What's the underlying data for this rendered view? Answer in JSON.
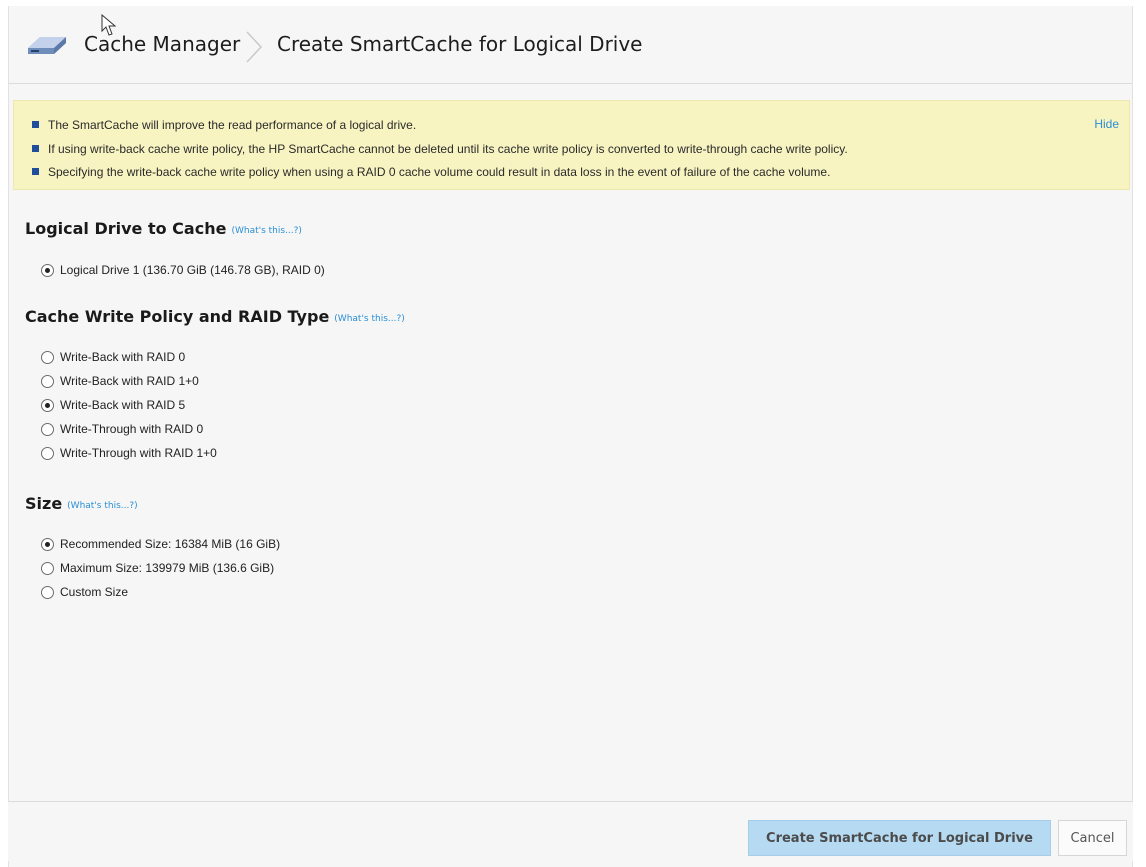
{
  "breadcrumb": {
    "parent": "Cache Manager",
    "current": "Create SmartCache for Logical Drive"
  },
  "notice": {
    "hide_label": "Hide",
    "lines": [
      "The SmartCache will improve the read performance of a logical drive.",
      "If using write-back cache write policy, the HP SmartCache cannot be deleted until its cache write policy is converted to write-through cache write policy.",
      "Specifying the write-back cache write policy when using a RAID 0 cache volume could result in data loss in the event of failure of the cache volume."
    ]
  },
  "sections": {
    "logical_drive": {
      "title": "Logical Drive to Cache",
      "help": "(What's this...?)",
      "options": [
        {
          "label": "Logical Drive 1 (136.70 GiB (146.78 GB), RAID 0)",
          "checked": true
        }
      ]
    },
    "policy": {
      "title": "Cache Write Policy and RAID Type",
      "help": "(What's this...?)",
      "options": [
        {
          "label": "Write-Back with RAID 0",
          "checked": false
        },
        {
          "label": "Write-Back with RAID 1+0",
          "checked": false
        },
        {
          "label": "Write-Back with RAID 5",
          "checked": true
        },
        {
          "label": "Write-Through with RAID 0",
          "checked": false
        },
        {
          "label": "Write-Through with RAID 1+0",
          "checked": false
        }
      ]
    },
    "size": {
      "title": "Size",
      "help": "(What's this...?)",
      "options": [
        {
          "label": "Recommended Size: 16384 MiB (16 GiB)",
          "checked": true
        },
        {
          "label": "Maximum Size: 139979 MiB (136.6 GiB)",
          "checked": false
        },
        {
          "label": "Custom Size",
          "checked": false
        }
      ]
    }
  },
  "footer": {
    "create_label": "Create SmartCache for Logical Drive",
    "cancel_label": "Cancel"
  },
  "colors": {
    "notice_bg": "#f8f4c2",
    "link": "#2a8fd6",
    "primary_button": "#b5daf2",
    "bullet": "#1f4e9a"
  }
}
